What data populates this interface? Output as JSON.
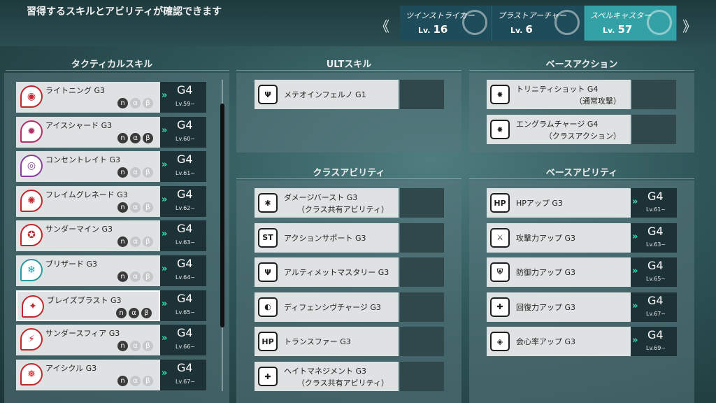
{
  "header": {
    "title": "習得するスキルとアビリティが確認できます",
    "prev_icon": "《",
    "next_icon": "》",
    "classes": [
      {
        "name": "ツインストライカー",
        "lv_prefix": "Lv.",
        "level": "16",
        "active": false
      },
      {
        "name": "ブラストアーチャー",
        "lv_prefix": "Lv.",
        "level": "6",
        "active": false
      },
      {
        "name": "スペルキャスター",
        "lv_prefix": "Lv.",
        "level": "57",
        "active": true
      }
    ]
  },
  "tactical": {
    "title": "タクティカルスキル",
    "abilities": [
      "n",
      "α",
      "β"
    ],
    "items": [
      {
        "name": "ライトニング G3",
        "grade": "G4",
        "lv": "Lv.59~",
        "icon": "lightning-icon",
        "glyph": "◉",
        "color": "#c0282f",
        "ability_on": [
          true,
          false,
          false
        ]
      },
      {
        "name": "アイスシャード G3",
        "grade": "G4",
        "lv": "Lv.60~",
        "icon": "ice-shard-icon",
        "glyph": "✹",
        "color": "#b0306a",
        "ability_on": [
          true,
          true,
          true
        ]
      },
      {
        "name": "コンセントレイト G3",
        "grade": "G4",
        "lv": "Lv.61~",
        "icon": "concentrate-icon",
        "glyph": "◎",
        "color": "#8a3fa0",
        "ability_on": [
          true,
          false,
          false
        ]
      },
      {
        "name": "フレイムグレネード G3",
        "grade": "G4",
        "lv": "Lv.62~",
        "icon": "flame-grenade-icon",
        "glyph": "✺",
        "color": "#c0282f",
        "ability_on": [
          true,
          false,
          false
        ]
      },
      {
        "name": "サンダーマイン G3",
        "grade": "G4",
        "lv": "Lv.63~",
        "icon": "thunder-mine-icon",
        "glyph": "✪",
        "color": "#c0282f",
        "ability_on": [
          true,
          false,
          false
        ]
      },
      {
        "name": "ブリザード G3",
        "grade": "G4",
        "lv": "Lv.64~",
        "icon": "blizzard-icon",
        "glyph": "❄",
        "color": "#2a9aa0",
        "ability_on": [
          true,
          false,
          false
        ]
      },
      {
        "name": "ブレイズブラスト G3",
        "grade": "G4",
        "lv": "Lv.65~",
        "icon": "blaze-blast-icon",
        "glyph": "✦",
        "color": "#c0282f",
        "ability_on": [
          true,
          true,
          true
        ]
      },
      {
        "name": "サンダースフィア G3",
        "grade": "G4",
        "lv": "Lv.66~",
        "icon": "thunder-sphere-icon",
        "glyph": "⚡",
        "color": "#c0282f",
        "ability_on": [
          true,
          false,
          false
        ]
      },
      {
        "name": "アイシクル G3",
        "grade": "G4",
        "lv": "Lv.67~",
        "icon": "icicle-icon",
        "glyph": "❅",
        "color": "#c0282f",
        "ability_on": [
          true,
          false,
          false
        ]
      }
    ]
  },
  "ult": {
    "title": "ULTスキル",
    "items": [
      {
        "name": "メテオインフェルノ G1",
        "icon": "meteor-inferno-icon",
        "glyph": "Ψ"
      }
    ]
  },
  "base_action": {
    "title": "ベースアクション",
    "items": [
      {
        "name": "トリニティショット G4",
        "sub": "（通常攻撃）",
        "icon": "trinity-shot-icon",
        "glyph": "✸"
      },
      {
        "name": "エングラムチャージ G4",
        "sub": "（クラスアクション）",
        "icon": "engram-charge-icon",
        "glyph": "✸"
      }
    ]
  },
  "class_ability": {
    "title": "クラスアビリティ",
    "items": [
      {
        "name": "ダメージバースト G3",
        "sub": "（クラス共有アビリティ）",
        "icon": "damage-burst-icon",
        "glyph": "✱"
      },
      {
        "name": "アクションサポート G3",
        "sub": "",
        "icon": "action-support-icon",
        "glyph": "ST"
      },
      {
        "name": "アルティメットマスタリー G3",
        "sub": "",
        "icon": "ultimate-mastery-icon",
        "glyph": "Ψ"
      },
      {
        "name": "ディフェンシヴチャージ G3",
        "sub": "",
        "icon": "defensive-charge-icon",
        "glyph": "◐"
      },
      {
        "name": "トランスファー G3",
        "sub": "",
        "icon": "transfer-icon",
        "glyph": "HP"
      },
      {
        "name": "ヘイトマネジメント G3",
        "sub": "（クラス共有アビリティ）",
        "icon": "hate-management-icon",
        "glyph": "✚"
      }
    ]
  },
  "base_ability": {
    "title": "ベースアビリティ",
    "items": [
      {
        "name": "HPアップ G3",
        "grade": "G4",
        "lv": "Lv.61~",
        "icon": "hp-up-icon",
        "glyph": "HP"
      },
      {
        "name": "攻撃力アップ G3",
        "grade": "G4",
        "lv": "Lv.63~",
        "icon": "attack-up-icon",
        "glyph": "⚔"
      },
      {
        "name": "防御力アップ G3",
        "grade": "G4",
        "lv": "Lv.65~",
        "icon": "defense-up-icon",
        "glyph": "⛨"
      },
      {
        "name": "回復力アップ G3",
        "grade": "G4",
        "lv": "Lv.67~",
        "icon": "recovery-up-icon",
        "glyph": "✚"
      },
      {
        "name": "会心率アップ G3",
        "grade": "G4",
        "lv": "Lv.69~",
        "icon": "critical-up-icon",
        "glyph": "◈"
      }
    ]
  }
}
